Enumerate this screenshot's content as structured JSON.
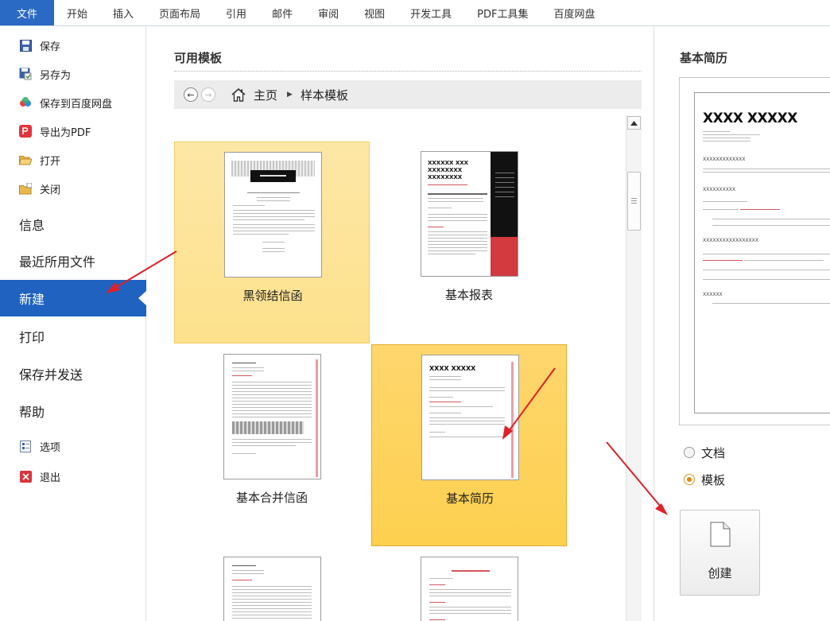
{
  "ribbon": {
    "tabs": [
      "文件",
      "开始",
      "插入",
      "页面布局",
      "引用",
      "邮件",
      "审阅",
      "视图",
      "开发工具",
      "PDF工具集",
      "百度网盘"
    ]
  },
  "nav": {
    "save": "保存",
    "save_as": "另存为",
    "save_baidu": "保存到百度网盘",
    "export_pdf": "导出为PDF",
    "open": "打开",
    "close": "关闭",
    "info": "信息",
    "recent": "最近所用文件",
    "new": "新建",
    "print": "打印",
    "save_send": "保存并发送",
    "help": "帮助",
    "options": "选项",
    "exit": "退出"
  },
  "middle": {
    "title": "可用模板",
    "breadcrumb": {
      "home": "主页",
      "current": "样本模板"
    }
  },
  "templates": [
    {
      "label": "黑领结信函",
      "state": "hover"
    },
    {
      "label": "基本报表",
      "state": "normal"
    },
    {
      "label": "基本合并信函",
      "state": "normal"
    },
    {
      "label": "基本简历",
      "state": "selected"
    }
  ],
  "thumb_text": {
    "report_title_1": "XXXXXX XXX",
    "report_title_2": "XXXXXXXX",
    "report_title_3": "XXXXXXXX",
    "resume_title": "XXXX XXXXX"
  },
  "preview": {
    "title": "基本简历",
    "page_heading": "XXXX XXXXX",
    "sections": [
      "XXXXXXXXXXXXX",
      "XXXXXXXXXX",
      "XXXXXXXXXXXXXXXXX",
      "XXXXXX"
    ]
  },
  "options": {
    "doc": "文档",
    "template": "模板",
    "selected": "模板"
  },
  "create_label": "创建",
  "colors": {
    "accent": "#2a6ac4",
    "nav_active": "#1f62c0",
    "selected_tile": "#fdd04f",
    "hover_tile": "#fde18c",
    "annotation_arrow": "#e0202a"
  }
}
